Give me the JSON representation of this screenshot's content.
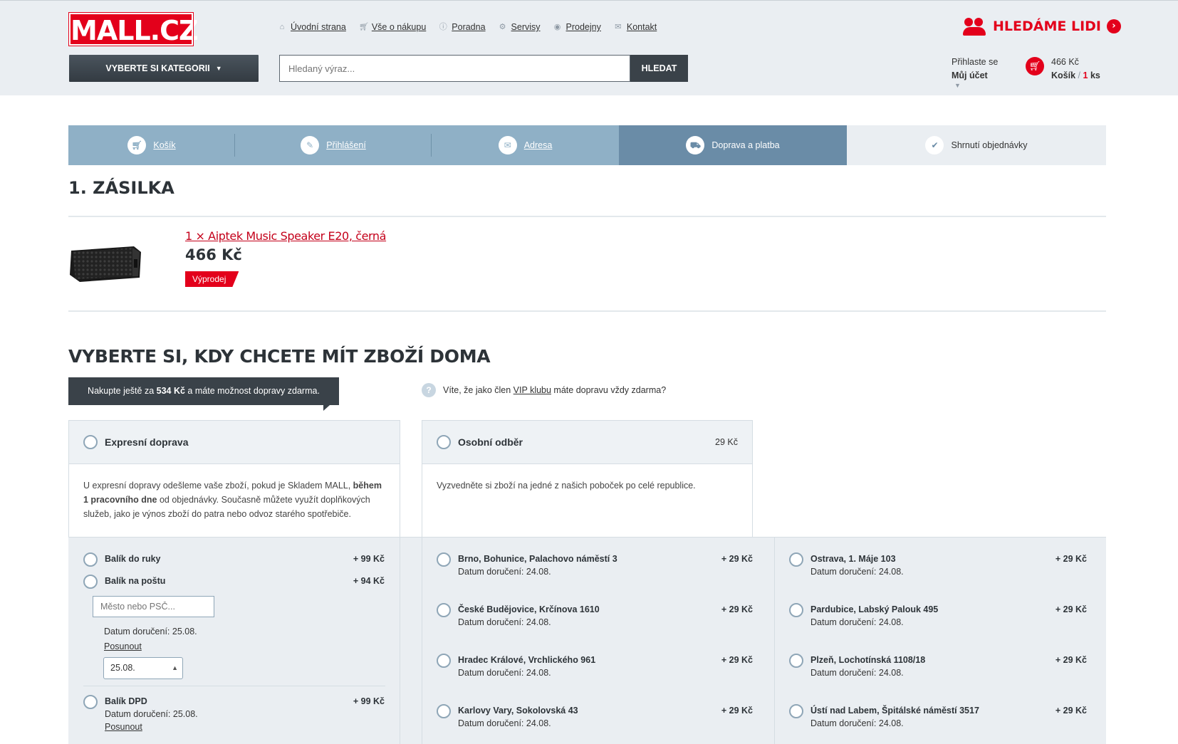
{
  "header": {
    "logo": "MALL.CZ",
    "nav": [
      "Úvodní strana",
      "Vše o nákupu",
      "Poradna",
      "Servisy",
      "Prodejny",
      "Kontakt"
    ],
    "jobs": "HLEDÁME LIDI",
    "category_button": "VYBERTE SI KATEGORII",
    "search_placeholder": "Hledaný výraz...",
    "search_button": "HLEDAT",
    "login_line": "Přihlaste se",
    "account": "Můj účet",
    "cart_price": "466 Kč",
    "cart_label": "Košík",
    "cart_sep": "/",
    "cart_count": "1",
    "cart_unit": "ks"
  },
  "steps": [
    {
      "label": "Košík",
      "icon": "cart-icon"
    },
    {
      "label": "Přihlášení",
      "icon": "pencil-icon"
    },
    {
      "label": "Adresa",
      "icon": "mail-icon"
    },
    {
      "label": "Doprava a platba",
      "icon": "truck-icon"
    },
    {
      "label": "Shrnutí objednávky",
      "icon": "check-icon"
    }
  ],
  "shipment": {
    "title": "1. ZÁSILKA",
    "product_name": "1 × Aiptek Music Speaker E20, černá",
    "product_price": "466 Kč",
    "badge": "Výprodej"
  },
  "delivery": {
    "title": "VYBERTE SI, KDY CHCETE MÍT ZBOŽÍ DOMA",
    "free_pre": "Nakupte ještě za ",
    "free_amount": "534 Kč",
    "free_post": " a máte možnost dopravy zdarma.",
    "vip_pre": "Víte, že jako člen ",
    "vip_link": "VIP klubu",
    "vip_post": " máte dopravu vždy zdarma?",
    "express": {
      "title": "Expresní doprava",
      "desc_pre": "U expresní dopravy odešleme vaše zboží, pokud je Skladem MALL, ",
      "desc_bold": "během 1 pracovního dne",
      "desc_post": " od objednávky. Současně můžete využít doplňkových služeb, jako je výnos zboží do patra nebo odvoz starého spotřebiče."
    },
    "pickup": {
      "title": "Osobní odběr",
      "price": "29 Kč",
      "desc": "Vyzvedněte si zboží na jedné z našich poboček po celé republice."
    },
    "express_options": {
      "hand": {
        "name": "Balík do ruky",
        "price": "+ 99 Kč"
      },
      "post": {
        "name": "Balík na poštu",
        "price": "+ 94 Kč",
        "placeholder": "Město nebo PSČ...",
        "date": "Datum doručení: 25.08.",
        "postpone": "Posunout",
        "select": "25.08."
      },
      "dpd": {
        "name": "Balík DPD",
        "price": "+ 99 Kč",
        "date": "Datum doručení: 25.08.",
        "postpone": "Posunout"
      }
    },
    "stores_left": [
      {
        "name": "Brno, Bohunice, Palachovo náměstí 3",
        "date": "Datum doručení: 24.08.",
        "price": "+ 29 Kč"
      },
      {
        "name": "České Budějovice, Krčínova 1610",
        "date": "Datum doručení: 24.08.",
        "price": "+ 29 Kč"
      },
      {
        "name": "Hradec Králové, Vrchlického 961",
        "date": "Datum doručení: 24.08.",
        "price": "+ 29 Kč"
      },
      {
        "name": "Karlovy Vary, Sokolovská 43",
        "date": "Datum doručení: 24.08.",
        "price": "+ 29 Kč"
      }
    ],
    "stores_right": [
      {
        "name": "Ostrava, 1. Máje 103",
        "date": "Datum doručení: 24.08.",
        "price": "+ 29 Kč"
      },
      {
        "name": "Pardubice, Labský Palouk 495",
        "date": "Datum doručení: 24.08.",
        "price": "+ 29 Kč"
      },
      {
        "name": "Plzeň, Lochotínská 1108/18",
        "date": "Datum doručení: 24.08.",
        "price": "+ 29 Kč"
      },
      {
        "name": "Ústí nad Labem, Špitálské náměstí 3517",
        "date": "Datum doručení: 24.08.",
        "price": "+ 29 Kč"
      }
    ]
  }
}
